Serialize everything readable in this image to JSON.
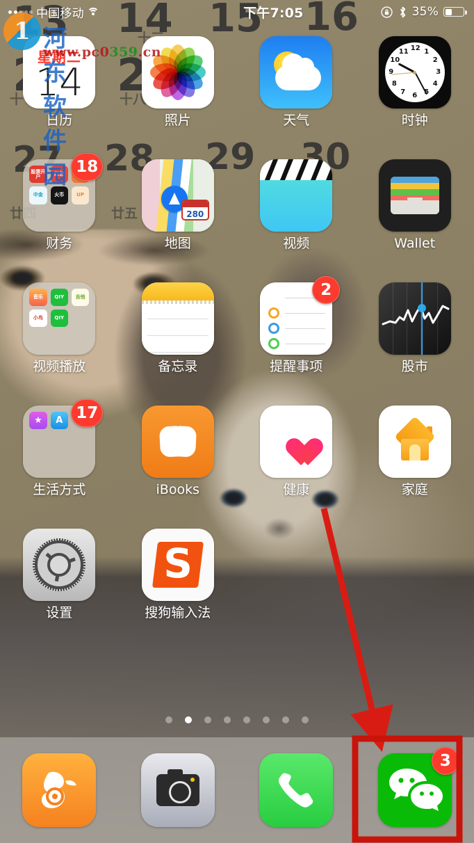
{
  "status_bar": {
    "carrier": "中国移动",
    "wifi_icon": "wifi-icon",
    "signal_icon": "signal-dots-icon",
    "time": "下午7:05",
    "rotation_lock_icon": "rotation-lock-icon",
    "bluetooth_icon": "bluetooth-icon",
    "battery_percent": "35%",
    "battery_level": 35
  },
  "watermark": {
    "logo_text": "1",
    "site_name": "河东软件园",
    "url_main": "www.pc0",
    "url_mid": "359",
    "url_end": ".cn"
  },
  "wallpaper": {
    "description": "calendar-page-with-woman-and-cat",
    "numbers": [
      "13",
      "14",
      "15",
      "16",
      "20",
      "21",
      "27",
      "28",
      "29",
      "30"
    ],
    "lunar_labels": [
      "十二",
      "十三",
      "十七",
      "十八",
      "廿四",
      "廿五"
    ]
  },
  "grid": {
    "rows": [
      [
        {
          "name": "calendar",
          "label": "日历",
          "type": "calendar",
          "weekday": "星期二",
          "day": "14",
          "badge": null
        },
        {
          "name": "photos",
          "label": "照片",
          "type": "photos",
          "badge": null
        },
        {
          "name": "weather",
          "label": "天气",
          "type": "weather",
          "badge": null
        },
        {
          "name": "clock",
          "label": "时钟",
          "type": "clock",
          "badge": null
        }
      ],
      [
        {
          "name": "finance-folder",
          "label": "财务",
          "type": "folder",
          "badge": "18",
          "minis": [
            "股票开户",
            "红包",
            "测评",
            "中金",
            "火币",
            "UP"
          ]
        },
        {
          "name": "maps",
          "label": "地图",
          "type": "maps",
          "route_shield": "280",
          "badge": null
        },
        {
          "name": "videos",
          "label": "视频",
          "type": "videos",
          "badge": null
        },
        {
          "name": "wallet",
          "label": "Wallet",
          "type": "wallet",
          "badge": null
        }
      ],
      [
        {
          "name": "video-player-folder",
          "label": "视频播放",
          "type": "folder",
          "badge": null,
          "minis": [
            "音乐",
            "QIY",
            "吉他",
            "小鸟",
            "QIY"
          ]
        },
        {
          "name": "notes",
          "label": "备忘录",
          "type": "notes",
          "badge": null
        },
        {
          "name": "reminders",
          "label": "提醒事项",
          "type": "reminders",
          "badge": "2"
        },
        {
          "name": "stocks",
          "label": "股市",
          "type": "stocks",
          "badge": null
        }
      ],
      [
        {
          "name": "lifestyle-folder",
          "label": "生活方式",
          "type": "folder",
          "badge": "17",
          "minis": [
            "iTunes",
            "App Store"
          ]
        },
        {
          "name": "ibooks",
          "label": "iBooks",
          "type": "ibooks",
          "badge": null
        },
        {
          "name": "health",
          "label": "健康",
          "type": "health",
          "badge": null
        },
        {
          "name": "home",
          "label": "家庭",
          "type": "home",
          "badge": null
        }
      ],
      [
        {
          "name": "settings",
          "label": "设置",
          "type": "settings",
          "badge": null
        },
        {
          "name": "sogou-input",
          "label": "搜狗输入法",
          "type": "sogou",
          "glyph": "S",
          "badge": null
        }
      ]
    ]
  },
  "page_dots": {
    "count": 8,
    "active_index": 1
  },
  "dock": {
    "items": [
      {
        "name": "uc-browser",
        "type": "uc",
        "badge": null
      },
      {
        "name": "camera",
        "type": "camera",
        "badge": null
      },
      {
        "name": "phone",
        "type": "phone",
        "badge": null
      },
      {
        "name": "wechat",
        "type": "wechat",
        "badge": "3"
      }
    ]
  },
  "annotations": {
    "arrow_color": "#d91c13",
    "highlight_box_color": "#c8140b",
    "arrow_target": "wechat-dock-icon",
    "highlight_target": "wechat-dock-icon"
  }
}
